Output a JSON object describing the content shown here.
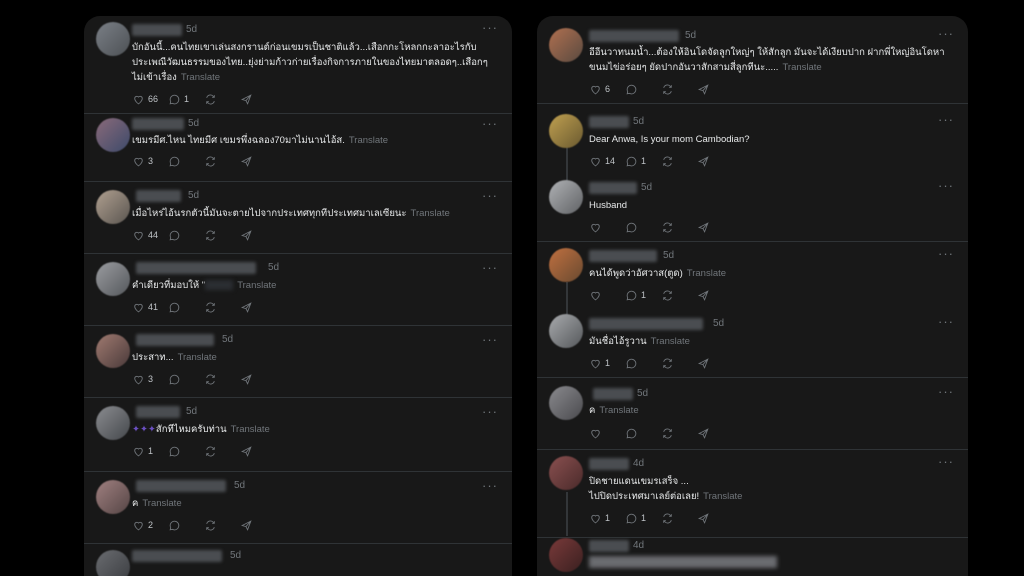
{
  "translate_label": "Translate",
  "more_label": "···",
  "left_posts": [
    {
      "time": "5d",
      "text": "บักอันนี้...คนไทยเขาเล่นสงกรานต์ก่อนเขมรเป็นชาติแล้ว...เสือกกะโหลกกะลาอะไรกับ",
      "text2": "ประเพณีวัฒนธรรมของไทย..ยุ่งย่ามก้าวก่ายเรื่องกิจการภายในของไทยมาตลอดๆ..เสือกๆ",
      "text3": "ไม่เข้าเรื่อง",
      "likes": "66",
      "replies": "1",
      "reposts": ""
    },
    {
      "time": "5d",
      "text": "เขมรมีศ.ไหน ไทยมีศ เขมรพึ่งฉลอง70มาไม่นานไอ้ส.",
      "likes": "3",
      "replies": "",
      "reposts": ""
    },
    {
      "time": "5d",
      "text": "เมื่อไหร่ไอ้นรกตัวนี้มันจะตายไปจากประเทศทุกทีประเทศมาเลเซียนะ",
      "likes": "44",
      "replies": "",
      "reposts": ""
    },
    {
      "time": "5d",
      "text": "คำเดียวที่มอบให้ \"",
      "likes": "41",
      "replies": "",
      "reposts": ""
    },
    {
      "time": "5d",
      "text": "ประสาท...",
      "likes": "3",
      "replies": "",
      "reposts": ""
    },
    {
      "time": "5d",
      "text": "สักทีไหมครับท่าน",
      "likes": "1",
      "replies": "",
      "reposts": ""
    },
    {
      "time": "5d",
      "text": "ค",
      "likes": "2",
      "replies": "",
      "reposts": ""
    },
    {
      "time": "5d",
      "text": "",
      "likes": "",
      "replies": "",
      "reposts": ""
    }
  ],
  "right_posts": [
    {
      "time": "5d",
      "text": "อีอีนวาทนมน้ำ...ต้องให้อินโดจัดลูกใหญ่ๆ ให้สักลูก มันจะได้เงียบปาก ฝากพี่ใหญ่อินโดหา",
      "text2": "ขนมไข่อร่อยๆ ยัดปากอันวาสักสามสี่ลูกทีนะ.....",
      "likes": "6",
      "replies": "",
      "reposts": ""
    },
    {
      "time": "5d",
      "text": "Dear Anwa, Is your mom Cambodian?",
      "likes": "14",
      "replies": "1",
      "reposts": ""
    },
    {
      "time": "5d",
      "text": "Husband",
      "likes": "",
      "replies": "",
      "reposts": ""
    },
    {
      "time": "5d",
      "text": "คนได้พูดว่าอัศวาส(ตูด)",
      "likes": "",
      "replies": "1",
      "reposts": ""
    },
    {
      "time": "5d",
      "text": "มันชื่อไอ้รูวาน",
      "likes": "1",
      "replies": "",
      "reposts": ""
    },
    {
      "time": "5d",
      "text": "ค",
      "likes": "",
      "replies": "",
      "reposts": ""
    },
    {
      "time": "4d",
      "text": "ปิดชายแดนเขมรเสร็จ ...",
      "text2": "ไปปิดประเทศมาเลย์ต่อเลย!",
      "likes": "1",
      "replies": "1",
      "reposts": ""
    },
    {
      "time": "4d",
      "text": "",
      "likes": "",
      "replies": "",
      "reposts": ""
    }
  ]
}
